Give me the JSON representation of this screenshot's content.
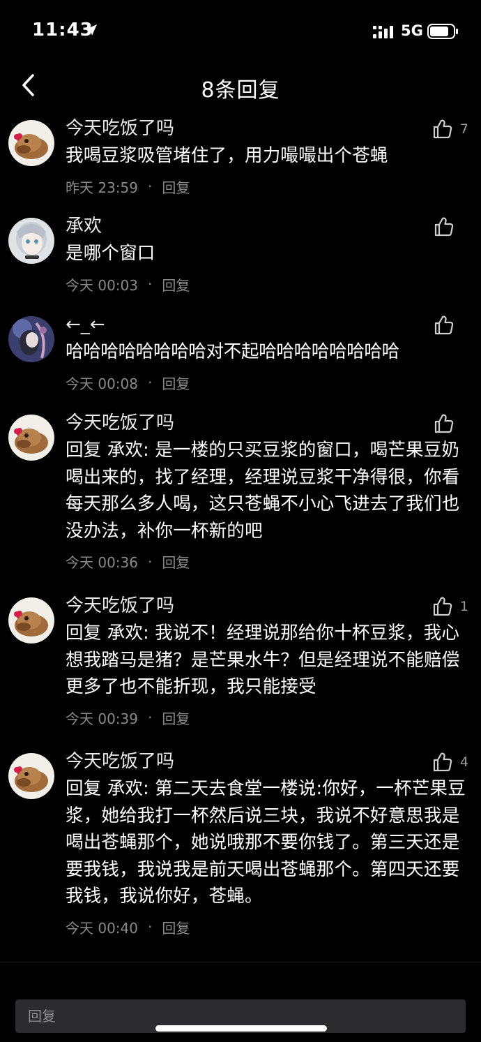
{
  "status_bar": {
    "time": "11:43",
    "network": "5G"
  },
  "nav": {
    "title": "8条回复"
  },
  "comments": [
    {
      "author": "今天吃饭了吗",
      "content": "我喝豆浆吸管堵住了，用力嘬嘬出个苍蝇",
      "time": "昨天 23:59",
      "reply_label": "回复",
      "likes": "7"
    },
    {
      "author": "承欢",
      "content": "是哪个窗口",
      "time": "今天 00:03",
      "reply_label": "回复",
      "likes": ""
    },
    {
      "author": "←_←",
      "content": "哈哈哈哈哈哈哈哈对不起哈哈哈哈哈哈哈哈",
      "time": "今天 00:08",
      "reply_label": "回复",
      "likes": ""
    },
    {
      "author": "今天吃饭了吗",
      "content": "回复 承欢: 是一楼的只买豆浆的窗口，喝芒果豆奶喝出来的，找了经理，经理说豆浆干净得很，你看每天那么多人喝，这只苍蝇不小心飞进去了我们也没办法，补你一杯新的吧",
      "time": "今天 00:36",
      "reply_label": "回复",
      "likes": ""
    },
    {
      "author": "今天吃饭了吗",
      "content": "回复 承欢: 我说不！经理说那给你十杯豆浆，我心想我踏马是猪？是芒果水牛？但是经理说不能赔偿更多了也不能折现，我只能接受",
      "time": "今天 00:39",
      "reply_label": "回复",
      "likes": "1"
    },
    {
      "author": "今天吃饭了吗",
      "content": "回复 承欢: 第二天去食堂一楼说:你好，一杯芒果豆浆，她给我打一杯然后说三块，我说不好意思我是喝出苍蝇那个，她说哦那不要你钱了。第三天还是要我钱，我说我是前天喝出苍蝇那个。第四天还要我钱，我说你好，苍蝇。",
      "time": "今天 00:40",
      "reply_label": "回复",
      "likes": "4"
    }
  ],
  "reply_box": {
    "placeholder": "回复"
  },
  "colors": {
    "background": "#000000",
    "text": "#ffffff",
    "meta": "#8a8a8a",
    "input_bg": "#2c2c2e"
  },
  "icons": {
    "back": "chevron-left-icon",
    "like": "thumbs-up-icon",
    "location": "location-arrow-icon",
    "signal": "signal-icon",
    "battery": "battery-icon"
  }
}
